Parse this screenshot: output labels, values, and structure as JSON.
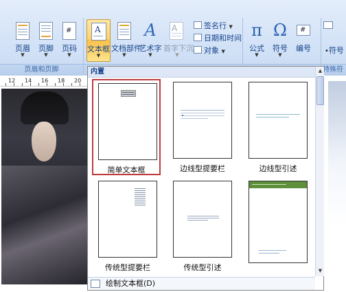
{
  "ribbon": {
    "header_footer": {
      "header_label": "页眉",
      "footer_label": "页脚",
      "page_number_label": "页码",
      "group_label": "页眉和页脚"
    },
    "text": {
      "textbox_label": "文本框",
      "quick_parts_label": "文档部件",
      "wordart_label": "艺术字",
      "dropcap_label": "首字下沉",
      "signature_label": "签名行",
      "datetime_label": "日期和时间",
      "object_label": "对象"
    },
    "symbols": {
      "equation_label": "公式",
      "symbol_label": "符号",
      "number_label": "编号",
      "right_symbol_label": "符号",
      "right_group_label": "特殊符"
    }
  },
  "ruler": {
    "ticks": [
      "12",
      "14",
      "16",
      "18",
      "20"
    ]
  },
  "gallery": {
    "section_title": "内置",
    "items": [
      {
        "caption": "简单文本框",
        "selected": true
      },
      {
        "caption": "边线型提要栏",
        "selected": false
      },
      {
        "caption": "边线型引述",
        "selected": false
      },
      {
        "caption": "传统型提要栏",
        "selected": false
      },
      {
        "caption": "传统型引述",
        "selected": false
      },
      {
        "caption": "",
        "selected": false
      }
    ],
    "footer_label": "绘制文本框(D)"
  },
  "colors": {
    "ribbon_bg": "#d4e3f7",
    "active_button": "#fbc14a",
    "selection_border": "#c0393b",
    "accent_green": "#5e8f3a"
  }
}
